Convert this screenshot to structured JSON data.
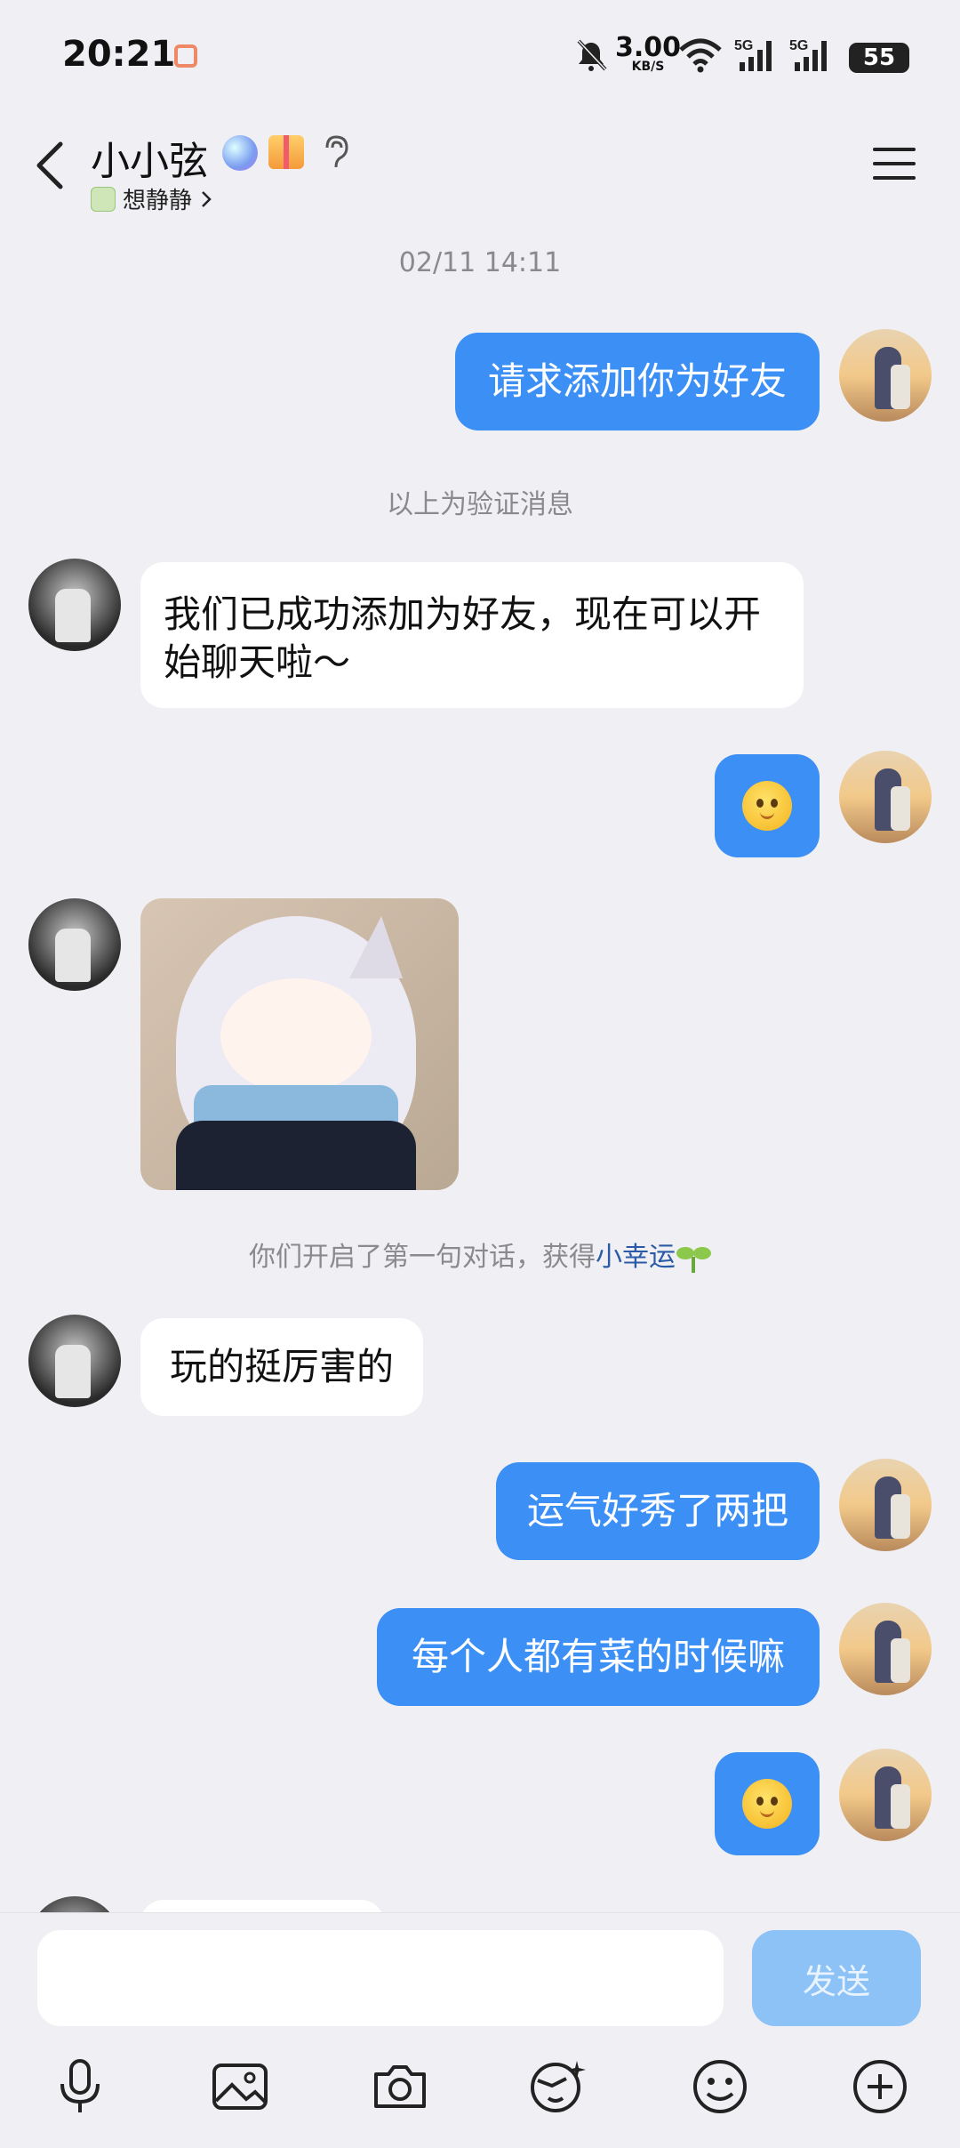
{
  "status_bar": {
    "time": "20:21",
    "net_speed": "3.00",
    "net_unit": "KB/S",
    "battery": "55"
  },
  "header": {
    "title": "小小弦",
    "subtitle": "想静静"
  },
  "chat": {
    "timestamp": "02/11 14:11",
    "msg_friend_request": "请求添加你为好友",
    "verify_note": "以上为验证消息",
    "msg_added": "我们已成功添加为好友，现在可以开始聊天啦～",
    "first_chat_note_prefix": "你们开启了第一句对话，获得",
    "first_chat_note_highlight": "小幸运",
    "msg_1": "玩的挺厉害的",
    "msg_2": "运气好秀了两把",
    "msg_3": "每个人都有菜的时候嘛"
  },
  "composer": {
    "send_label": "发送"
  },
  "colors": {
    "accent": "#3b8ff5",
    "send_disabled": "#8cc2f6",
    "background": "#f0f0f4"
  }
}
